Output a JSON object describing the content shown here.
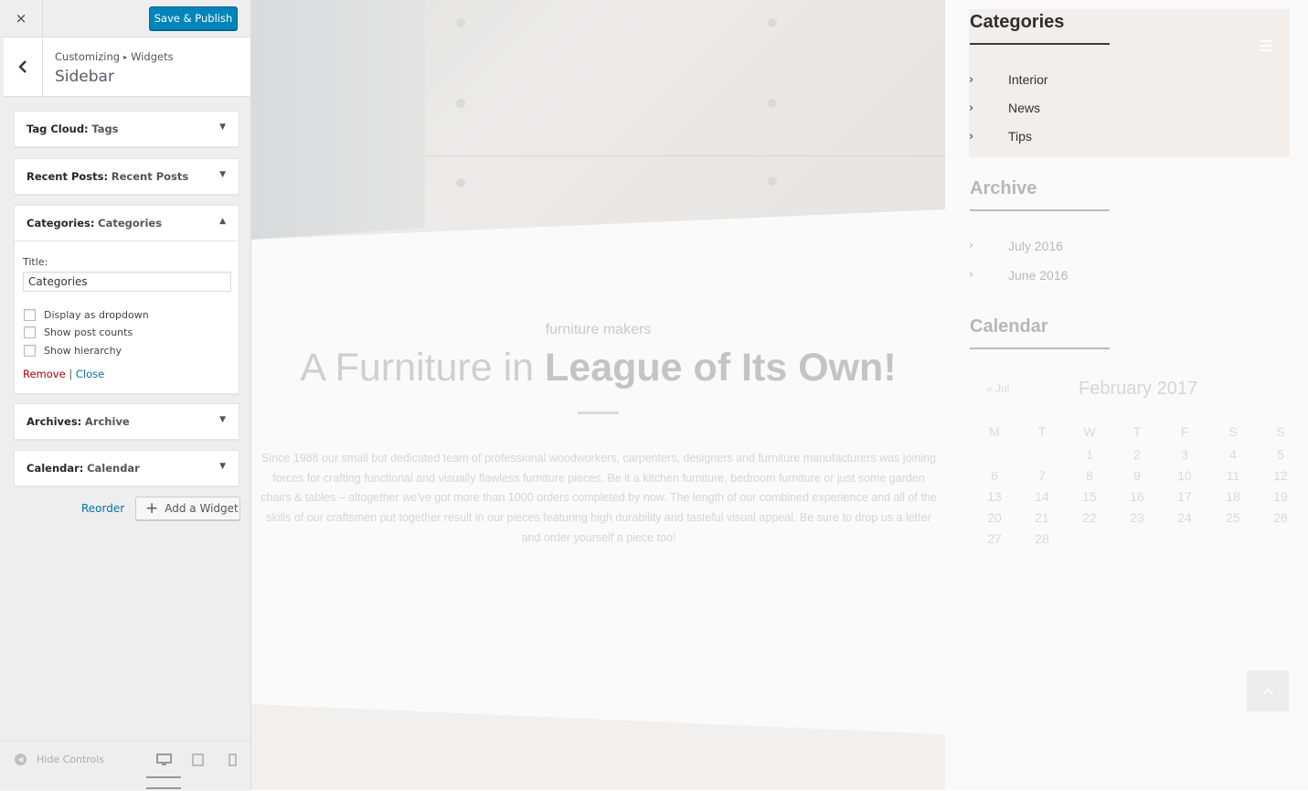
{
  "panel": {
    "close_icon": "×",
    "save_label": "Save & Publish",
    "breadcrumb": {
      "root": "Customizing",
      "separator": "▸",
      "current": "Widgets"
    },
    "section_title": "Sidebar",
    "widgets": [
      {
        "name": "Tag Cloud:",
        "title": "Tags",
        "state": "collapsed",
        "arrow": "▼"
      },
      {
        "name": "Recent Posts:",
        "title": "Recent Posts",
        "state": "collapsed",
        "arrow": "▼"
      },
      {
        "name": "Categories:",
        "title": "Categories",
        "state": "expanded",
        "arrow": "▲"
      },
      {
        "name": "Archives:",
        "title": "Archive",
        "state": "collapsed",
        "arrow": "▼"
      },
      {
        "name": "Calendar:",
        "title": "Calendar",
        "state": "collapsed",
        "arrow": "▼"
      }
    ],
    "categories_form": {
      "title_label": "Title:",
      "title_value": "Categories",
      "options": [
        {
          "label": "Display as dropdown",
          "checked": false
        },
        {
          "label": "Show post counts",
          "checked": false
        },
        {
          "label": "Show hierarchy",
          "checked": false
        }
      ],
      "remove_label": "Remove",
      "divider": "|",
      "close_label": "Close"
    },
    "reorder_label": "Reorder",
    "add_widget_label": "Add a Widget",
    "add_widget_icon": "+",
    "footer": {
      "hide_controls_label": "Hide Controls",
      "devices": [
        "desktop",
        "tablet",
        "mobile"
      ]
    }
  },
  "preview": {
    "hero": {
      "kicker": "furniture makers",
      "headline_light": "A Furniture in",
      "headline_bold": "League of Its Own!",
      "body": "Since 1988 our small but dedicated team of professional woodworkers, carpenters, designers and furniture manufacturers was joining forces for crafting functional and visually flawless furniture pieces. Be it a kitchen furniture, bedroom furniture or just some garden chairs & tables – altogether we've got more than 1000 orders completed by now. The length of our combined experience and all of the skills of our craftsmen put together result in our pieces featuring high durability and tasteful visual appeal. Be sure to drop us a letter and order yourself a piece too!"
    },
    "sidebar": {
      "categories": {
        "title": "Categories",
        "items": [
          "Interior",
          "News",
          "Tips"
        ]
      },
      "archive": {
        "title": "Archive",
        "items": [
          "July 2016",
          "June 2016"
        ]
      },
      "calendar": {
        "title": "Calendar",
        "prev_link": "« Jul",
        "month": "February 2017",
        "weekdays": [
          "M",
          "T",
          "W",
          "T",
          "F",
          "S",
          "S"
        ],
        "weeks": [
          [
            "",
            "",
            "1",
            "2",
            "3",
            "4",
            "5"
          ],
          [
            "6",
            "7",
            "8",
            "9",
            "10",
            "11",
            "12"
          ],
          [
            "13",
            "14",
            "15",
            "16",
            "17",
            "18",
            "19"
          ],
          [
            "20",
            "21",
            "22",
            "23",
            "24",
            "25",
            "26"
          ],
          [
            "27",
            "28",
            "",
            "",
            "",
            "",
            ""
          ]
        ]
      }
    },
    "back_to_top_icon": "chevron-up-icon"
  }
}
